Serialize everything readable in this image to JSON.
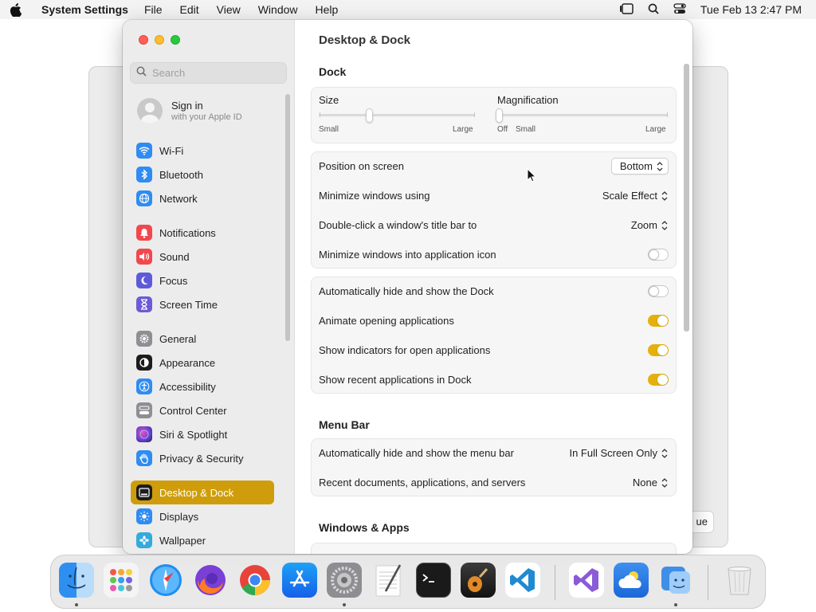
{
  "menubar": {
    "app_name": "System Settings",
    "menus": [
      "File",
      "Edit",
      "View",
      "Window",
      "Help"
    ],
    "datetime": "Tue Feb 13  2:47 PM",
    "status_icons": [
      "stage-manager-icon",
      "spotlight-search-icon",
      "control-center-icon"
    ]
  },
  "background": {
    "button_partial_label": "ue"
  },
  "sidebar": {
    "search_placeholder": "Search",
    "account": {
      "title": "Sign in",
      "subtitle": "with your Apple ID"
    },
    "items": [
      {
        "label": "Wi-Fi",
        "icon": "wifi-icon",
        "color": "#2f8cf2"
      },
      {
        "label": "Bluetooth",
        "icon": "bluetooth-icon",
        "color": "#2f8cf2"
      },
      {
        "label": "Network",
        "icon": "globe-icon",
        "color": "#2f8cf2"
      },
      {
        "label": "Notifications",
        "icon": "bell-icon",
        "color": "#f0484e"
      },
      {
        "label": "Sound",
        "icon": "speaker-icon",
        "color": "#f0484e"
      },
      {
        "label": "Focus",
        "icon": "moon-icon",
        "color": "#5d5bd9"
      },
      {
        "label": "Screen Time",
        "icon": "hourglass-icon",
        "color": "#6c5bd6"
      },
      {
        "label": "General",
        "icon": "gear-icon",
        "color": "#8e8e93"
      },
      {
        "label": "Appearance",
        "icon": "appearance-icon",
        "color": "#1c1c1e"
      },
      {
        "label": "Accessibility",
        "icon": "accessibility-icon",
        "color": "#2f8cf2"
      },
      {
        "label": "Control Center",
        "icon": "control-center-icon",
        "color": "#8e8e93"
      },
      {
        "label": "Siri & Spotlight",
        "icon": "siri-icon",
        "color": "#8a4fd8"
      },
      {
        "label": "Privacy & Security",
        "icon": "hand-icon",
        "color": "#2f8cf2"
      },
      {
        "label": "Desktop & Dock",
        "icon": "dock-icon",
        "color": "#1c1c1e"
      },
      {
        "label": "Displays",
        "icon": "sun-icon",
        "color": "#2f8cf2"
      },
      {
        "label": "Wallpaper",
        "icon": "flower-icon",
        "color": "#35aadc"
      }
    ],
    "active_item": "Desktop & Dock"
  },
  "content": {
    "title": "Desktop & Dock",
    "dock_section": "Dock",
    "size": {
      "label": "Size",
      "min_label": "Small",
      "max_label": "Large",
      "value": 0.33
    },
    "magnification": {
      "label": "Magnification",
      "off_label": "Off",
      "min_label": "Small",
      "max_label": "Large",
      "value": 0
    },
    "rows_a": [
      {
        "label": "Position on screen",
        "value": "Bottom"
      },
      {
        "label": "Minimize windows using",
        "value": "Scale Effect"
      },
      {
        "label": "Double-click a window's title bar to",
        "value": "Zoom"
      },
      {
        "label": "Minimize windows into application icon",
        "toggle": false
      }
    ],
    "rows_b": [
      {
        "label": "Automatically hide and show the Dock",
        "toggle": false
      },
      {
        "label": "Animate opening applications",
        "toggle": true
      },
      {
        "label": "Show indicators for open applications",
        "toggle": true
      },
      {
        "label": "Show recent applications in Dock",
        "toggle": true
      }
    ],
    "menubar_section": "Menu Bar",
    "rows_c": [
      {
        "label": "Automatically hide and show the menu bar",
        "value": "In Full Screen Only"
      },
      {
        "label": "Recent documents, applications, and servers",
        "value": "None"
      }
    ],
    "windows_section": "Windows & Apps"
  },
  "dock": {
    "apps": [
      {
        "name": "Finder",
        "icon": "finder-icon",
        "running": true
      },
      {
        "name": "Launchpad",
        "icon": "launchpad-icon",
        "running": false
      },
      {
        "name": "Safari",
        "icon": "safari-icon",
        "running": false
      },
      {
        "name": "Firefox",
        "icon": "firefox-icon",
        "running": false
      },
      {
        "name": "Chrome",
        "icon": "chrome-icon",
        "running": false
      },
      {
        "name": "App Store",
        "icon": "app-store-icon",
        "running": false
      },
      {
        "name": "System Settings",
        "icon": "system-settings-icon",
        "running": true
      },
      {
        "name": "TextEdit",
        "icon": "textedit-icon",
        "running": false
      },
      {
        "name": "Terminal",
        "icon": "terminal-icon",
        "running": false
      },
      {
        "name": "GarageBand",
        "icon": "garageband-icon",
        "running": false
      },
      {
        "name": "Visual Studio Code",
        "icon": "vscode-icon",
        "running": false
      },
      {
        "name": "Visual Studio",
        "icon": "visual-studio-icon",
        "running": false
      },
      {
        "name": "Weather",
        "icon": "weather-icon",
        "running": false
      },
      {
        "name": "Migration Assistant",
        "icon": "migration-assistant-icon",
        "running": true
      },
      {
        "name": "Trash",
        "icon": "trash-icon",
        "running": false
      }
    ]
  }
}
